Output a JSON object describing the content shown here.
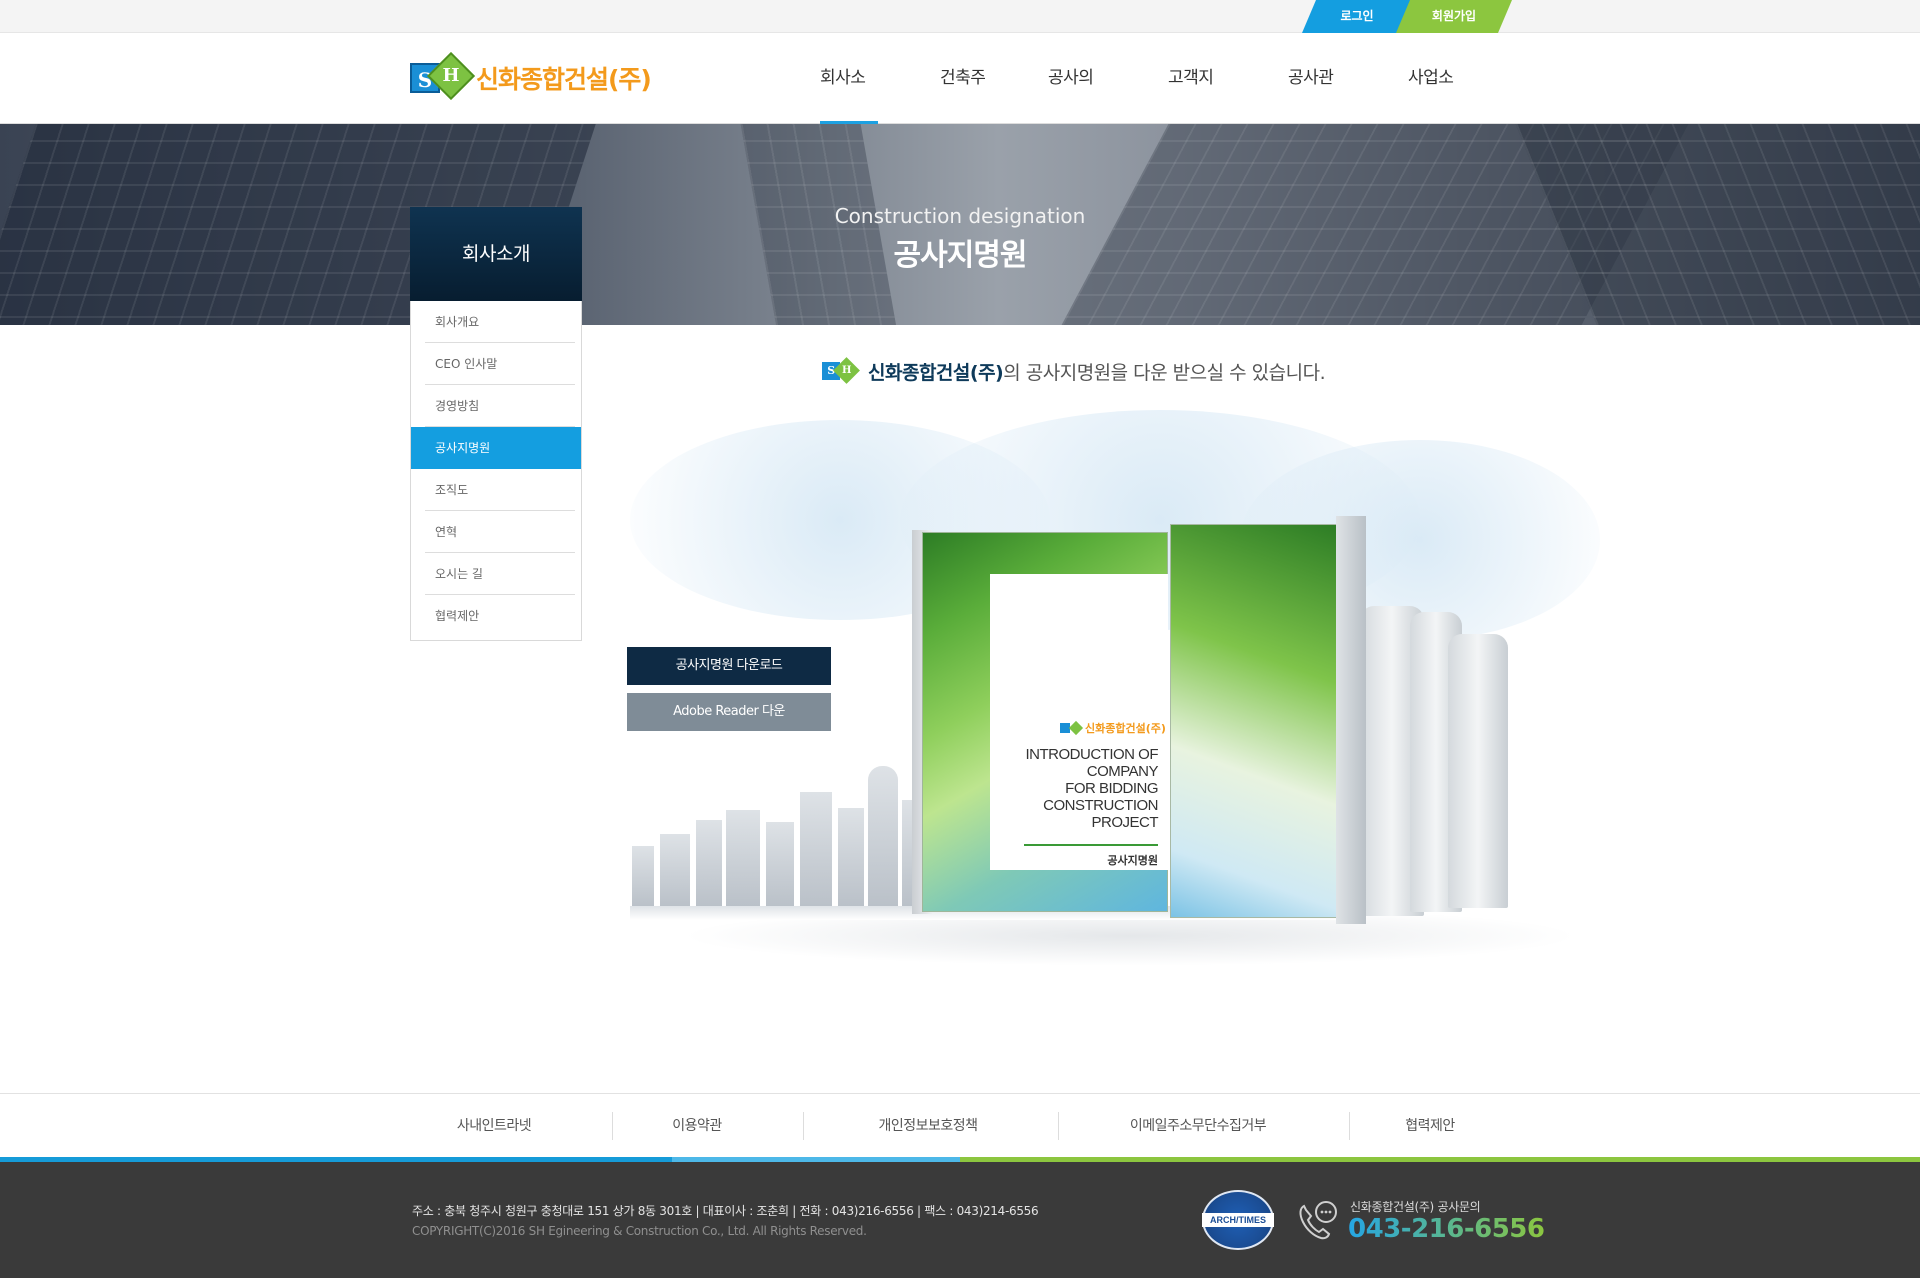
{
  "top_links": {
    "login": "로그인",
    "join": "회원가입"
  },
  "logo": {
    "mark_s": "S",
    "mark_h": "H",
    "text": "신화종합건설(주)"
  },
  "gnb": [
    "회사소개",
    "건축주",
    "공사의뢰",
    "고객지원",
    "공사관리",
    "사업소개"
  ],
  "gnb_active": "회사소개",
  "banner": {
    "subtitle": "Construction designation",
    "title": "공사지명원"
  },
  "lnb": {
    "title": "회사소개",
    "items": [
      "회사개요",
      "CEO 인사말",
      "경영방침",
      "공사지명원",
      "조직도",
      "연혁",
      "오시는 길",
      "협력제안"
    ],
    "active": "공사지명원"
  },
  "intro": {
    "brand": "신화종합건설(주)",
    "text": "의 공사지명원을 다운 받으실 수 있습니다."
  },
  "book": {
    "logo_text": "신화종합건설(주)",
    "cover_title": [
      "INTRODUCTION OF",
      "COMPANY",
      "FOR BIDDING",
      "CONSTRUCTION",
      "PROJECT"
    ],
    "cover_caption": "공사지명원"
  },
  "buttons": {
    "download": "공사지명원 다운로드",
    "reader": "Adobe Reader 다운"
  },
  "footer_nav": [
    "사내인트라넷",
    "이용약관",
    "개인정보보호정책",
    "이메일주소무단수집거부",
    "협력제안"
  ],
  "footer": {
    "address": "주소 : 충북 청주시 청원구 충청대로 151 상가 8동 301호   |   대표이사 : 조춘희   |   전화 : 043)216-6556   |   팩스 : 043)214-6556",
    "copyright": "COPYRIGHT(C)2016  SH Egineering & Construction  Co., Ltd. All Rights Reserved.",
    "seal_text": "ARCH/TIMES",
    "cs_label": "신화종합건설(주) 공사문의",
    "cs_number": "043-216-6556"
  },
  "colors": {
    "accent_blue": "#149ee0",
    "accent_green": "#8cc63f",
    "navy": "#0e2a44",
    "logo_orange": "#f39a1c"
  }
}
